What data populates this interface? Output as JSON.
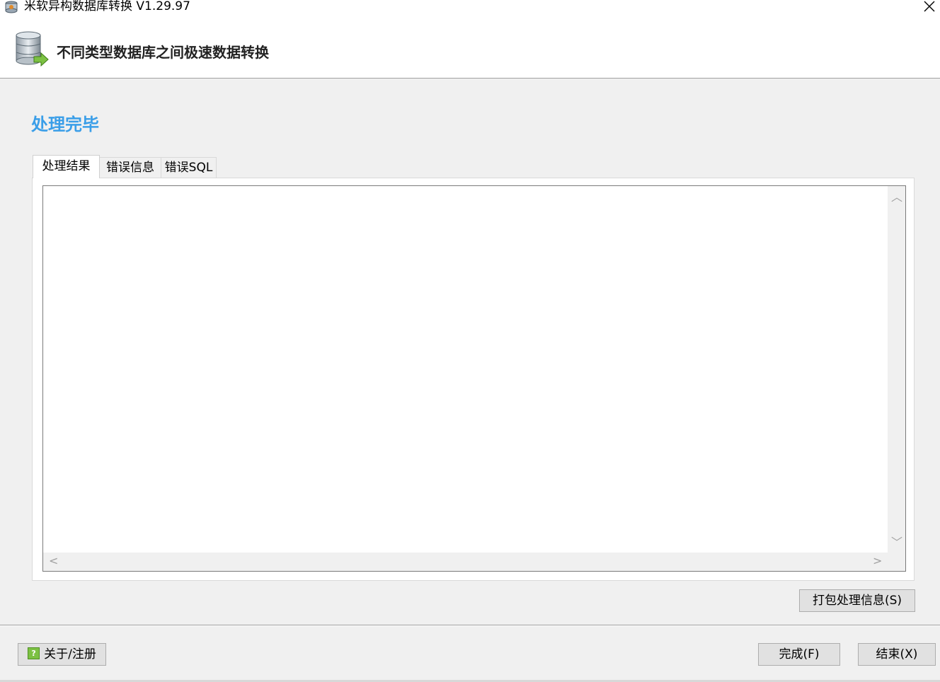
{
  "window": {
    "title": "米软异构数据库转换 V1.29.97",
    "close_glyph": "✕"
  },
  "header": {
    "title": "不同类型数据库之间极速数据转换",
    "icon": "database-arrow-icon"
  },
  "section_title": "处理完毕",
  "tabs": [
    {
      "label": "处理结果",
      "active": true
    },
    {
      "label": "错误信息",
      "active": false
    },
    {
      "label": "错误SQL",
      "active": false
    }
  ],
  "result_text": "",
  "buttons": {
    "package_info": "打包处理信息(S)",
    "about": "关于/注册",
    "finish": "完成(F)",
    "end": "结束(X)"
  },
  "colors": {
    "section_title": "#3a9ee8",
    "background": "#f0f0f0",
    "button_bg": "#e1e1e1"
  }
}
